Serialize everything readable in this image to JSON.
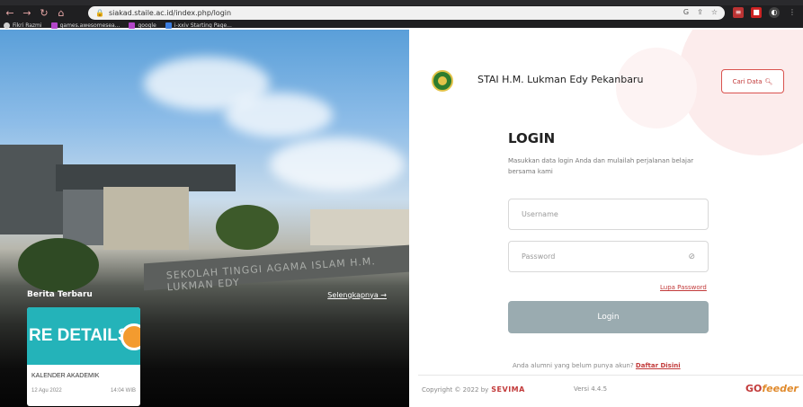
{
  "browser": {
    "url": "siakad.staile.ac.id/index.php/login",
    "bookmarks": [
      {
        "label": "Fikri Razmi",
        "color": "#cfcfcf"
      },
      {
        "label": "games.awesomesea...",
        "color": "#b246c9"
      },
      {
        "label": "google",
        "color": "#b246c9"
      },
      {
        "label": "i-xxiv Starting Page...",
        "color": "#3a7de0"
      }
    ]
  },
  "hero": {
    "building_sign": "SEKOLAH TINGGI AGAMA ISLAM H.M. LUKMAN EDY",
    "news_title": "Berita Terbaru",
    "news_more": "Selengkapnya →",
    "card": {
      "image_text": "RE DETAILS",
      "title": "KALENDER AKADEMIK",
      "date": "12 Agu 2022",
      "time": "14:04 WIB"
    }
  },
  "panel": {
    "institution": "STAI H.M. Lukman Edy Pekanbaru",
    "cari_data": "Cari Data",
    "login_title": "LOGIN",
    "login_desc": "Masukkan data login Anda dan mulailah perjalanan belajar bersama kami",
    "username_placeholder": "Username",
    "password_placeholder": "Password",
    "lupa_password": "Lupa Password",
    "login_button": "Login",
    "alumni_text": "Anda alumni yang belum punya akun?",
    "daftar_link": "Daftar Disini",
    "copyright": "Copyright © 2022 by",
    "sevima": "SEVIMA",
    "versi": "Versi 4.4.5",
    "gofeeder_go": "GO",
    "gofeeder_feeder": "feeder"
  },
  "colors": {
    "accent": "#c23a3a",
    "login_button": "#9aabb0",
    "card_image": "#24b3b9"
  }
}
